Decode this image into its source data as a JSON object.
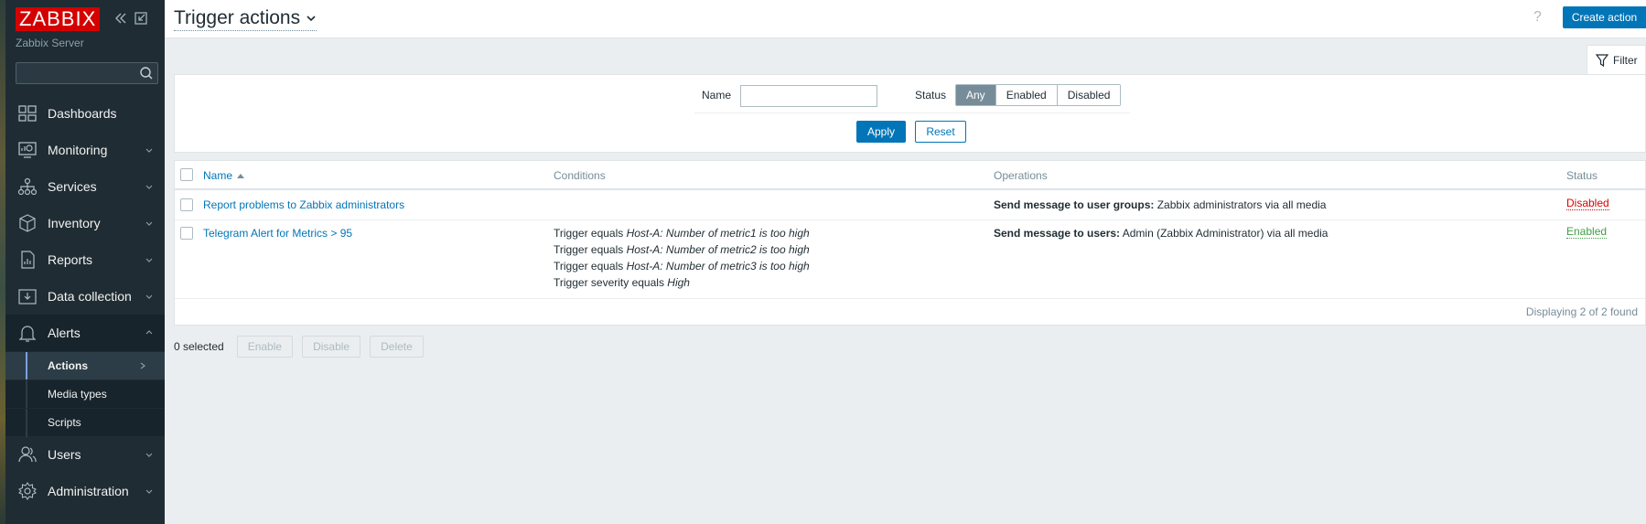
{
  "app": {
    "logo_text": "ZABBIX",
    "server_name": "Zabbix Server",
    "search_value": ""
  },
  "sidebar": {
    "items": [
      {
        "label": "Dashboards",
        "icon": "dashboards-icon"
      },
      {
        "label": "Monitoring",
        "icon": "monitoring-icon"
      },
      {
        "label": "Services",
        "icon": "services-icon"
      },
      {
        "label": "Inventory",
        "icon": "inventory-icon"
      },
      {
        "label": "Reports",
        "icon": "reports-icon"
      },
      {
        "label": "Data collection",
        "icon": "data-collection-icon"
      },
      {
        "label": "Alerts",
        "icon": "alerts-icon"
      },
      {
        "label": "Users",
        "icon": "users-icon"
      },
      {
        "label": "Administration",
        "icon": "administration-icon"
      }
    ],
    "alerts_submenu": [
      {
        "label": "Actions"
      },
      {
        "label": "Media types"
      },
      {
        "label": "Scripts"
      }
    ]
  },
  "header": {
    "title": "Trigger actions",
    "help": "?",
    "create_button": "Create action"
  },
  "filter": {
    "tab_label": "Filter",
    "name_label": "Name",
    "name_value": "",
    "status_label": "Status",
    "status_options": [
      "Any",
      "Enabled",
      "Disabled"
    ],
    "status_selected": "Any",
    "apply_label": "Apply",
    "reset_label": "Reset"
  },
  "table": {
    "columns": [
      "Name",
      "Conditions",
      "Operations",
      "Status"
    ],
    "sort_column": "Name",
    "rows": [
      {
        "name": "Report problems to Zabbix administrators",
        "conditions": [],
        "operation_bold": "Send message to user groups:",
        "operation_text": " Zabbix administrators via all media",
        "status": "Disabled"
      },
      {
        "name": "Telegram Alert for Metrics > 95",
        "conditions": [
          {
            "prefix": "Trigger equals ",
            "italic": "Host-A: Number of metric1 is too high"
          },
          {
            "prefix": "Trigger equals ",
            "italic": "Host-A: Number of metric2 is too high"
          },
          {
            "prefix": "Trigger equals ",
            "italic": "Host-A: Number of metric3 is too high"
          },
          {
            "prefix": "Trigger severity equals ",
            "italic": "High"
          }
        ],
        "operation_bold": "Send message to users:",
        "operation_text": " Admin (Zabbix Administrator) via all media",
        "status": "Enabled"
      }
    ],
    "footer": "Displaying 2 of 2 found"
  },
  "actions": {
    "selected_count": "0 selected",
    "enable": "Enable",
    "disable": "Disable",
    "delete": "Delete"
  },
  "colors": {
    "sidebar_bg": "#1f2c33",
    "accent": "#0275b8",
    "logo_red": "#d40000",
    "disabled_red": "#dc0000",
    "enabled_green": "#429e47"
  }
}
